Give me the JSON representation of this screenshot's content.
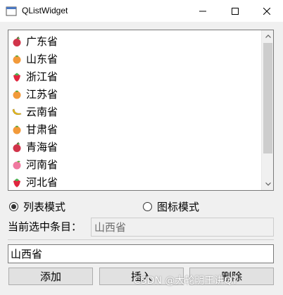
{
  "window": {
    "title": "QListWidget",
    "icon": "qt-app-icon"
  },
  "list": {
    "items": [
      {
        "label": "广东省",
        "icon": "apple-icon"
      },
      {
        "label": "山东省",
        "icon": "orange-icon"
      },
      {
        "label": "浙江省",
        "icon": "strawberry-icon"
      },
      {
        "label": "江苏省",
        "icon": "orange-icon"
      },
      {
        "label": "云南省",
        "icon": "banana-icon"
      },
      {
        "label": "甘肃省",
        "icon": "orange-icon"
      },
      {
        "label": "青海省",
        "icon": "apple-icon"
      },
      {
        "label": "河南省",
        "icon": "peach-icon"
      },
      {
        "label": "河北省",
        "icon": "strawberry-icon"
      }
    ],
    "scroll_fraction_visible": 0.82
  },
  "mode": {
    "list_label": "列表模式",
    "icon_label": "图标模式",
    "selected": "list"
  },
  "current": {
    "label": "当前选中条目：",
    "value": "山西省"
  },
  "input": {
    "value": "山西省"
  },
  "buttons": {
    "add": "添加",
    "insert": "插入",
    "delete": "删除"
  },
  "watermark": "CSDN @大轮明王讲QT",
  "colors": {
    "selection": "#cce8ff",
    "apple": "#d1344a",
    "orange": "#f29a3a",
    "strawberry": "#e0263f",
    "banana": "#f5c91b",
    "peach": "#f07aa0"
  }
}
